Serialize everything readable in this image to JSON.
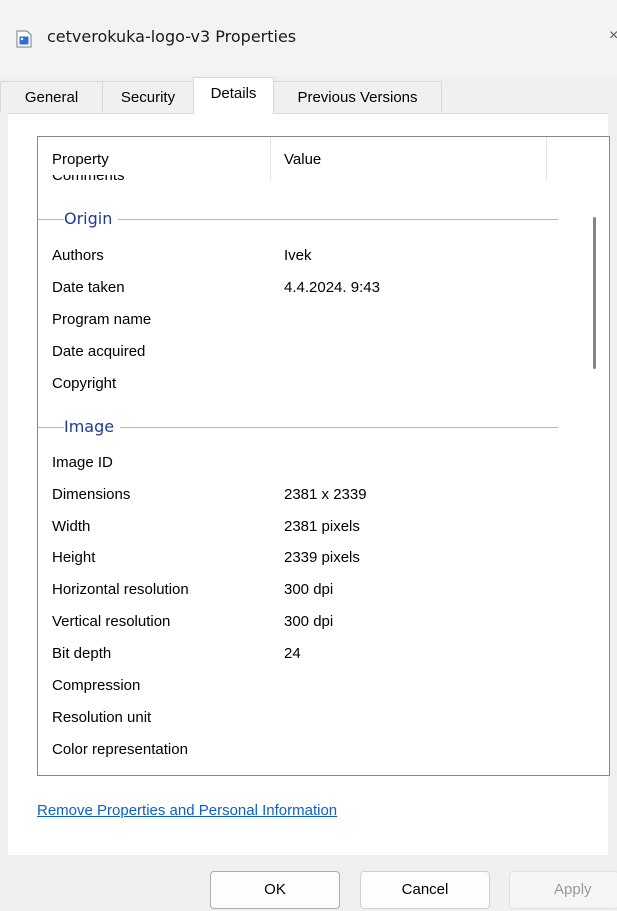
{
  "window": {
    "title": "cetverokuka-logo-v3 Properties",
    "close_partial": "×"
  },
  "tabs": [
    {
      "label": "General"
    },
    {
      "label": "Security"
    },
    {
      "label": "Details"
    },
    {
      "label": "Previous Versions"
    }
  ],
  "details": {
    "header": {
      "property": "Property",
      "value": "Value"
    },
    "cut_row": "Comments",
    "groups": [
      {
        "label": "Origin",
        "rows": [
          {
            "name": "Authors",
            "value": "Ivek"
          },
          {
            "name": "Date taken",
            "value": "4.4.2024. 9:43"
          },
          {
            "name": "Program name",
            "value": ""
          },
          {
            "name": "Date acquired",
            "value": ""
          },
          {
            "name": "Copyright",
            "value": ""
          }
        ]
      },
      {
        "label": "Image",
        "rows": [
          {
            "name": "Image ID",
            "value": ""
          },
          {
            "name": "Dimensions",
            "value": "2381 x 2339"
          },
          {
            "name": "Width",
            "value": "2381 pixels"
          },
          {
            "name": "Height",
            "value": "2339 pixels"
          },
          {
            "name": "Horizontal resolution",
            "value": "300 dpi"
          },
          {
            "name": "Vertical resolution",
            "value": "300 dpi"
          },
          {
            "name": "Bit depth",
            "value": "24"
          },
          {
            "name": "Compression",
            "value": ""
          },
          {
            "name": "Resolution unit",
            "value": ""
          },
          {
            "name": "Color representation",
            "value": ""
          }
        ]
      }
    ]
  },
  "link": {
    "label": "Remove Properties and Personal Information"
  },
  "buttons": {
    "ok": "OK",
    "cancel": "Cancel",
    "apply": "Apply"
  },
  "colors": {
    "group_label": "#1e3c96",
    "link": "#0b62c3"
  }
}
